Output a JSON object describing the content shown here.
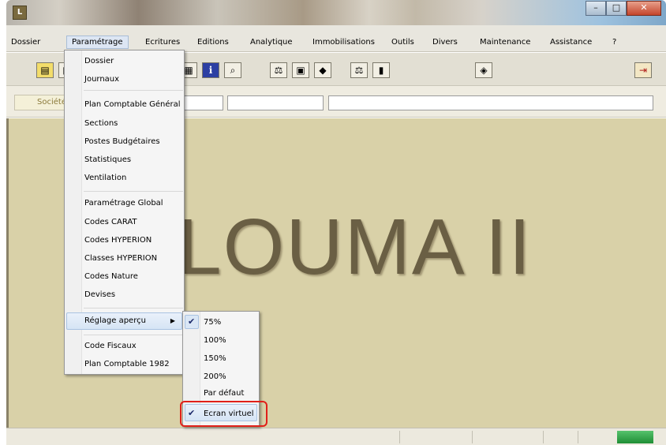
{
  "menubar": {
    "items": [
      {
        "label": "Dossier"
      },
      {
        "label": "Paramétrage"
      },
      {
        "label": "Ecritures"
      },
      {
        "label": "Editions"
      },
      {
        "label": "Analytique"
      },
      {
        "label": "Immobilisations"
      },
      {
        "label": "Outils"
      },
      {
        "label": "Divers"
      },
      {
        "label": "Maintenance"
      },
      {
        "label": "Assistance"
      },
      {
        "label": "?"
      }
    ]
  },
  "infobar": {
    "societe_label": "Société"
  },
  "main": {
    "logo_text": "LOUMA II"
  },
  "parametrage_menu": {
    "items": [
      {
        "label": "Dossier"
      },
      {
        "label": "Journaux"
      },
      {
        "label": "Plan Comptable Général"
      },
      {
        "label": "Sections"
      },
      {
        "label": "Postes Budgétaires"
      },
      {
        "label": "Statistiques"
      },
      {
        "label": "Ventilation"
      },
      {
        "label": "Paramétrage Global"
      },
      {
        "label": "Codes CARAT"
      },
      {
        "label": "Codes HYPERION"
      },
      {
        "label": "Classes HYPERION"
      },
      {
        "label": "Codes Nature"
      },
      {
        "label": "Devises"
      },
      {
        "label": "Réglage aperçu"
      },
      {
        "label": "Code Fiscaux"
      },
      {
        "label": "Plan Comptable 1982"
      }
    ]
  },
  "reglage_submenu": {
    "items": [
      {
        "label": "75%",
        "checked": true
      },
      {
        "label": "100%",
        "checked": false
      },
      {
        "label": "150%",
        "checked": false
      },
      {
        "label": "200%",
        "checked": false
      },
      {
        "label": "Par défaut",
        "checked": false
      },
      {
        "label": "Ecran virtuel",
        "checked": true
      }
    ]
  },
  "colors": {
    "highlight_outline": "#e0201a",
    "main_bg": "#d9d1a8"
  }
}
